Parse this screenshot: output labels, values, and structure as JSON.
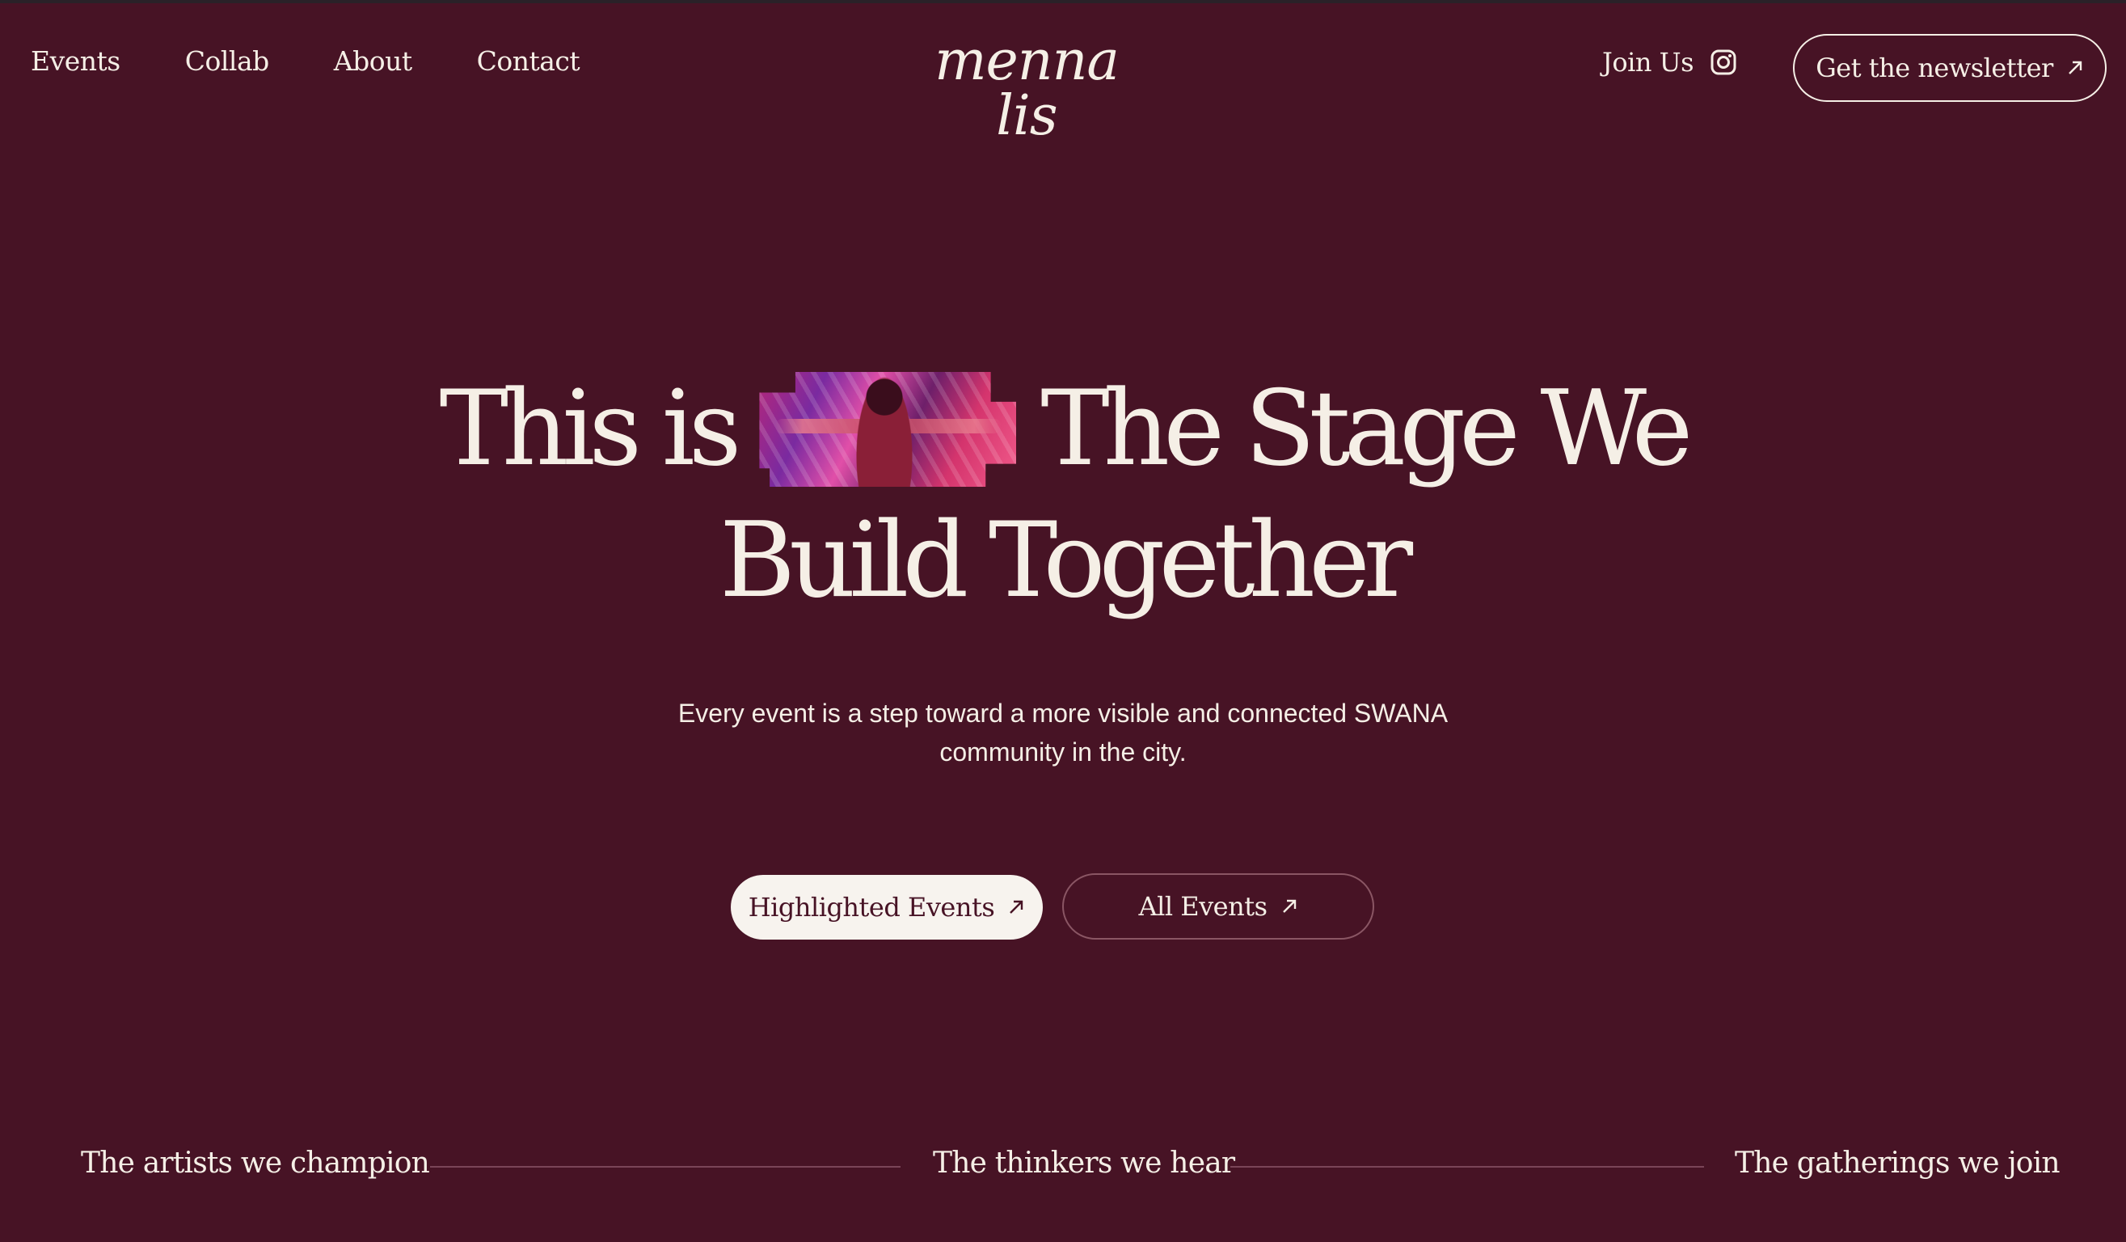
{
  "nav": {
    "links": [
      "Events",
      "Collab",
      "About",
      "Contact"
    ],
    "logo": "menna lis",
    "join_label": "Join Us",
    "join_icon": "instagram-icon",
    "newsletter_label": "Get the newsletter",
    "newsletter_icon": "arrow-up-right-icon"
  },
  "hero": {
    "line1_a": "This is",
    "line1_b": "The Stage We",
    "line2": "Build Together",
    "image": "performer-photo",
    "subtitle": "Every event is a step toward a more visible and connected SWANA community in the city."
  },
  "buttons": {
    "primary_label": "Highlighted Events",
    "secondary_label": "All Events",
    "icon": "arrow-up-right-icon"
  },
  "strip": {
    "items": [
      "The artists we champion",
      "The thinkers we hear",
      "The gatherings we join"
    ]
  },
  "colors": {
    "background": "#471325",
    "text": "#f5efe6",
    "button_fill": "#f7f3ee"
  }
}
